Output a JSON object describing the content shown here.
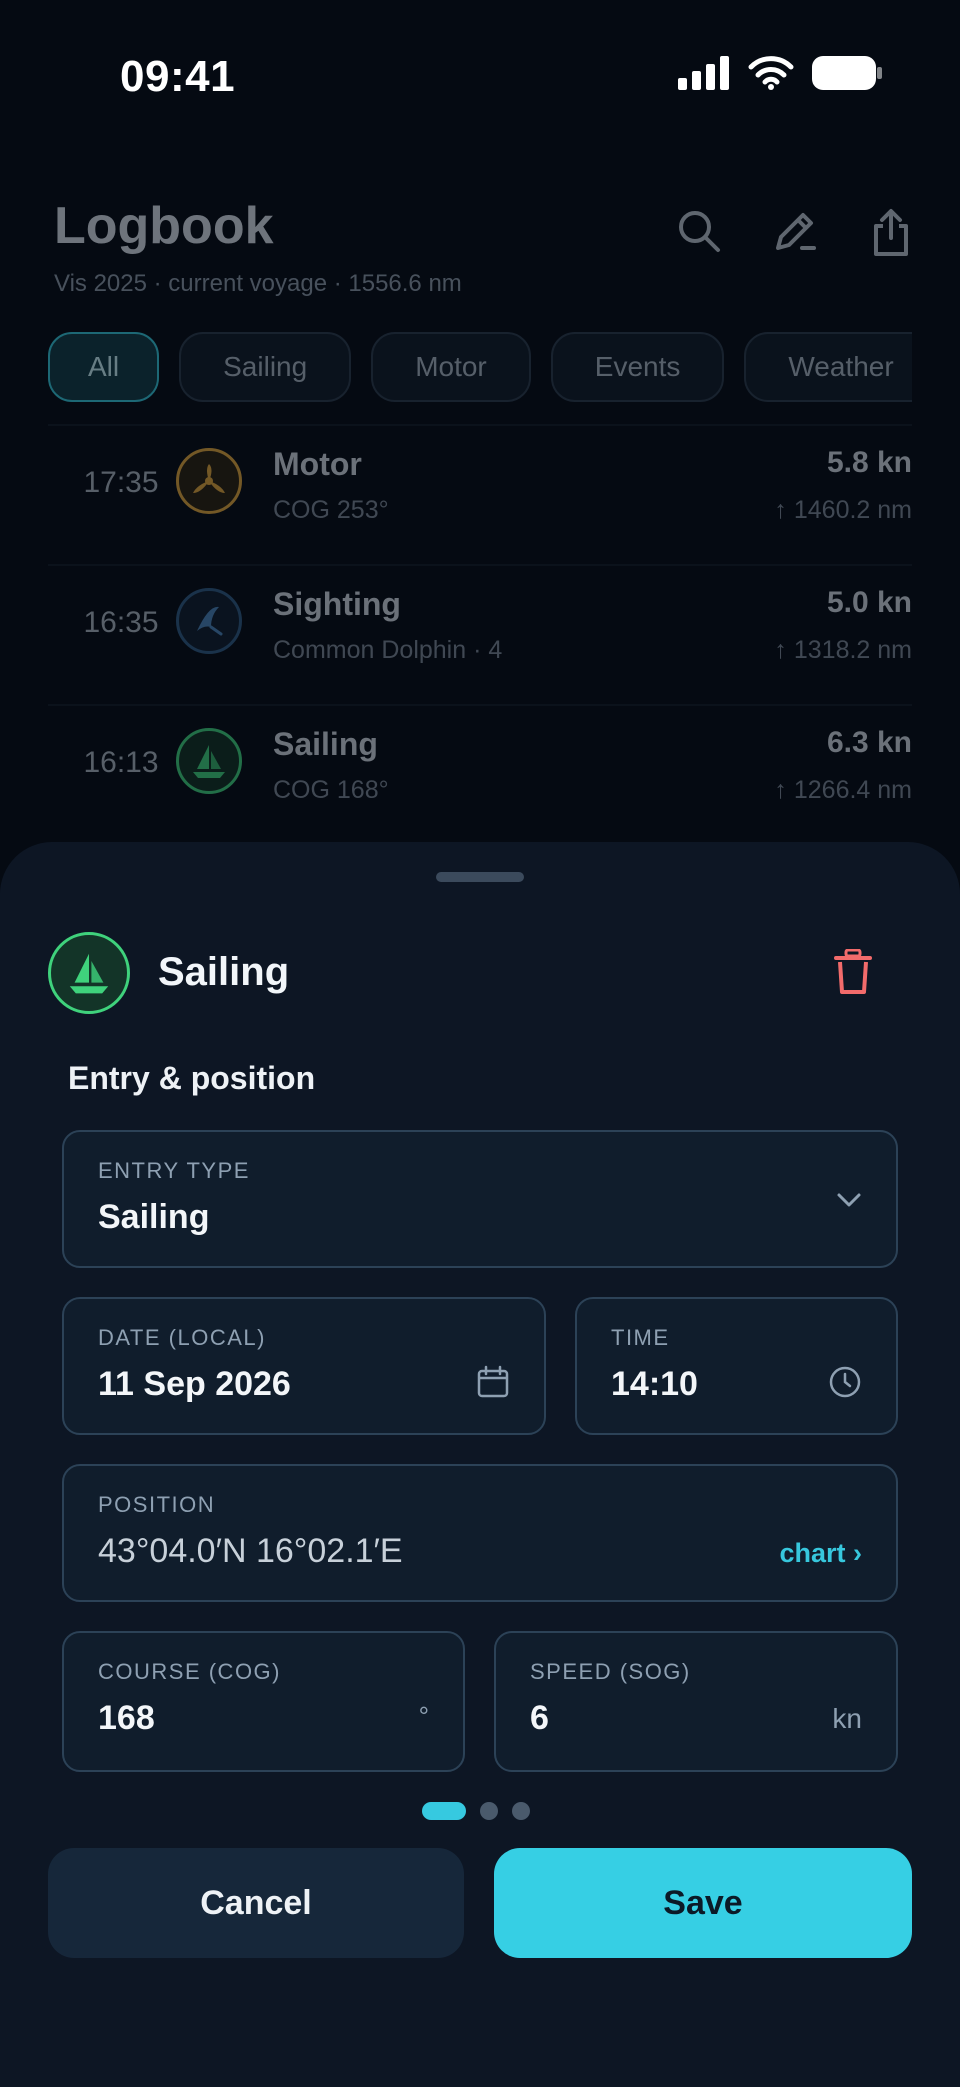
{
  "status_bar": {
    "time": "09:41"
  },
  "header": {
    "title": "Logbook",
    "subtitle": "Vis 2025 · current voyage · 1556.6 nm"
  },
  "filters": [
    {
      "label": "All",
      "active": true
    },
    {
      "label": "Sailing",
      "active": false
    },
    {
      "label": "Motor",
      "active": false
    },
    {
      "label": "Events",
      "active": false
    },
    {
      "label": "Weather",
      "active": false
    }
  ],
  "log_entries": [
    {
      "time": "17:35",
      "name": "Motor",
      "detail": "COG 253°",
      "speed": "5.8 kn",
      "distance": "↑ 1460.2 nm",
      "icon": "propeller-icon",
      "color": "#e0a53a"
    },
    {
      "time": "16:35",
      "name": "Sighting",
      "detail": "Common Dolphin · 4",
      "speed": "5.0 kn",
      "distance": "↑ 1318.2 nm",
      "icon": "dolphin-fin-icon",
      "color": "#4a83b8"
    },
    {
      "time": "16:13",
      "name": "Sailing",
      "detail": "COG 168°",
      "speed": "6.3 kn",
      "distance": "↑ 1266.4 nm",
      "icon": "sailboat-icon",
      "color": "#3fd27c"
    }
  ],
  "sheet": {
    "title": "Sailing",
    "section_title": "Entry & position",
    "entry_type": {
      "label": "ENTRY TYPE",
      "value": "Sailing"
    },
    "date": {
      "label": "DATE (LOCAL)",
      "value": "11 Sep 2026"
    },
    "time": {
      "label": "TIME",
      "value": "14:10"
    },
    "position": {
      "label": "POSITION",
      "value": "43°04.0′N 16°02.1′E",
      "link": "chart ›"
    },
    "course": {
      "label": "COURSE (COG)",
      "value": "168",
      "unit": "°"
    },
    "speed": {
      "label": "SPEED (SOG)",
      "value": "6",
      "unit": "kn"
    },
    "pager": {
      "pages": 3,
      "current": 1
    },
    "cancel_label": "Cancel",
    "save_label": "Save"
  },
  "colors": {
    "accent": "#36cfe4",
    "sailing_green": "#3fd27c",
    "delete_red": "#f26b6b"
  }
}
